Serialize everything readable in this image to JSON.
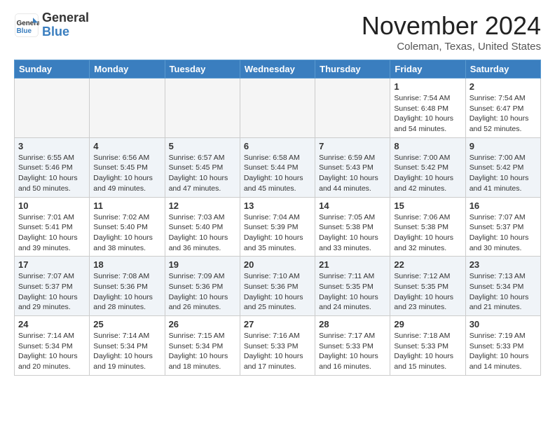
{
  "header": {
    "logo_general": "General",
    "logo_blue": "Blue",
    "month_title": "November 2024",
    "location": "Coleman, Texas, United States"
  },
  "days_of_week": [
    "Sunday",
    "Monday",
    "Tuesday",
    "Wednesday",
    "Thursday",
    "Friday",
    "Saturday"
  ],
  "weeks": [
    {
      "alt": false,
      "days": [
        {
          "day": "",
          "info": ""
        },
        {
          "day": "",
          "info": ""
        },
        {
          "day": "",
          "info": ""
        },
        {
          "day": "",
          "info": ""
        },
        {
          "day": "",
          "info": ""
        },
        {
          "day": "1",
          "info": "Sunrise: 7:54 AM\nSunset: 6:48 PM\nDaylight: 10 hours and 54 minutes."
        },
        {
          "day": "2",
          "info": "Sunrise: 7:54 AM\nSunset: 6:47 PM\nDaylight: 10 hours and 52 minutes."
        }
      ]
    },
    {
      "alt": true,
      "days": [
        {
          "day": "3",
          "info": "Sunrise: 6:55 AM\nSunset: 5:46 PM\nDaylight: 10 hours and 50 minutes."
        },
        {
          "day": "4",
          "info": "Sunrise: 6:56 AM\nSunset: 5:45 PM\nDaylight: 10 hours and 49 minutes."
        },
        {
          "day": "5",
          "info": "Sunrise: 6:57 AM\nSunset: 5:45 PM\nDaylight: 10 hours and 47 minutes."
        },
        {
          "day": "6",
          "info": "Sunrise: 6:58 AM\nSunset: 5:44 PM\nDaylight: 10 hours and 45 minutes."
        },
        {
          "day": "7",
          "info": "Sunrise: 6:59 AM\nSunset: 5:43 PM\nDaylight: 10 hours and 44 minutes."
        },
        {
          "day": "8",
          "info": "Sunrise: 7:00 AM\nSunset: 5:42 PM\nDaylight: 10 hours and 42 minutes."
        },
        {
          "day": "9",
          "info": "Sunrise: 7:00 AM\nSunset: 5:42 PM\nDaylight: 10 hours and 41 minutes."
        }
      ]
    },
    {
      "alt": false,
      "days": [
        {
          "day": "10",
          "info": "Sunrise: 7:01 AM\nSunset: 5:41 PM\nDaylight: 10 hours and 39 minutes."
        },
        {
          "day": "11",
          "info": "Sunrise: 7:02 AM\nSunset: 5:40 PM\nDaylight: 10 hours and 38 minutes."
        },
        {
          "day": "12",
          "info": "Sunrise: 7:03 AM\nSunset: 5:40 PM\nDaylight: 10 hours and 36 minutes."
        },
        {
          "day": "13",
          "info": "Sunrise: 7:04 AM\nSunset: 5:39 PM\nDaylight: 10 hours and 35 minutes."
        },
        {
          "day": "14",
          "info": "Sunrise: 7:05 AM\nSunset: 5:38 PM\nDaylight: 10 hours and 33 minutes."
        },
        {
          "day": "15",
          "info": "Sunrise: 7:06 AM\nSunset: 5:38 PM\nDaylight: 10 hours and 32 minutes."
        },
        {
          "day": "16",
          "info": "Sunrise: 7:07 AM\nSunset: 5:37 PM\nDaylight: 10 hours and 30 minutes."
        }
      ]
    },
    {
      "alt": true,
      "days": [
        {
          "day": "17",
          "info": "Sunrise: 7:07 AM\nSunset: 5:37 PM\nDaylight: 10 hours and 29 minutes."
        },
        {
          "day": "18",
          "info": "Sunrise: 7:08 AM\nSunset: 5:36 PM\nDaylight: 10 hours and 28 minutes."
        },
        {
          "day": "19",
          "info": "Sunrise: 7:09 AM\nSunset: 5:36 PM\nDaylight: 10 hours and 26 minutes."
        },
        {
          "day": "20",
          "info": "Sunrise: 7:10 AM\nSunset: 5:36 PM\nDaylight: 10 hours and 25 minutes."
        },
        {
          "day": "21",
          "info": "Sunrise: 7:11 AM\nSunset: 5:35 PM\nDaylight: 10 hours and 24 minutes."
        },
        {
          "day": "22",
          "info": "Sunrise: 7:12 AM\nSunset: 5:35 PM\nDaylight: 10 hours and 23 minutes."
        },
        {
          "day": "23",
          "info": "Sunrise: 7:13 AM\nSunset: 5:34 PM\nDaylight: 10 hours and 21 minutes."
        }
      ]
    },
    {
      "alt": false,
      "days": [
        {
          "day": "24",
          "info": "Sunrise: 7:14 AM\nSunset: 5:34 PM\nDaylight: 10 hours and 20 minutes."
        },
        {
          "day": "25",
          "info": "Sunrise: 7:14 AM\nSunset: 5:34 PM\nDaylight: 10 hours and 19 minutes."
        },
        {
          "day": "26",
          "info": "Sunrise: 7:15 AM\nSunset: 5:34 PM\nDaylight: 10 hours and 18 minutes."
        },
        {
          "day": "27",
          "info": "Sunrise: 7:16 AM\nSunset: 5:33 PM\nDaylight: 10 hours and 17 minutes."
        },
        {
          "day": "28",
          "info": "Sunrise: 7:17 AM\nSunset: 5:33 PM\nDaylight: 10 hours and 16 minutes."
        },
        {
          "day": "29",
          "info": "Sunrise: 7:18 AM\nSunset: 5:33 PM\nDaylight: 10 hours and 15 minutes."
        },
        {
          "day": "30",
          "info": "Sunrise: 7:19 AM\nSunset: 5:33 PM\nDaylight: 10 hours and 14 minutes."
        }
      ]
    }
  ]
}
